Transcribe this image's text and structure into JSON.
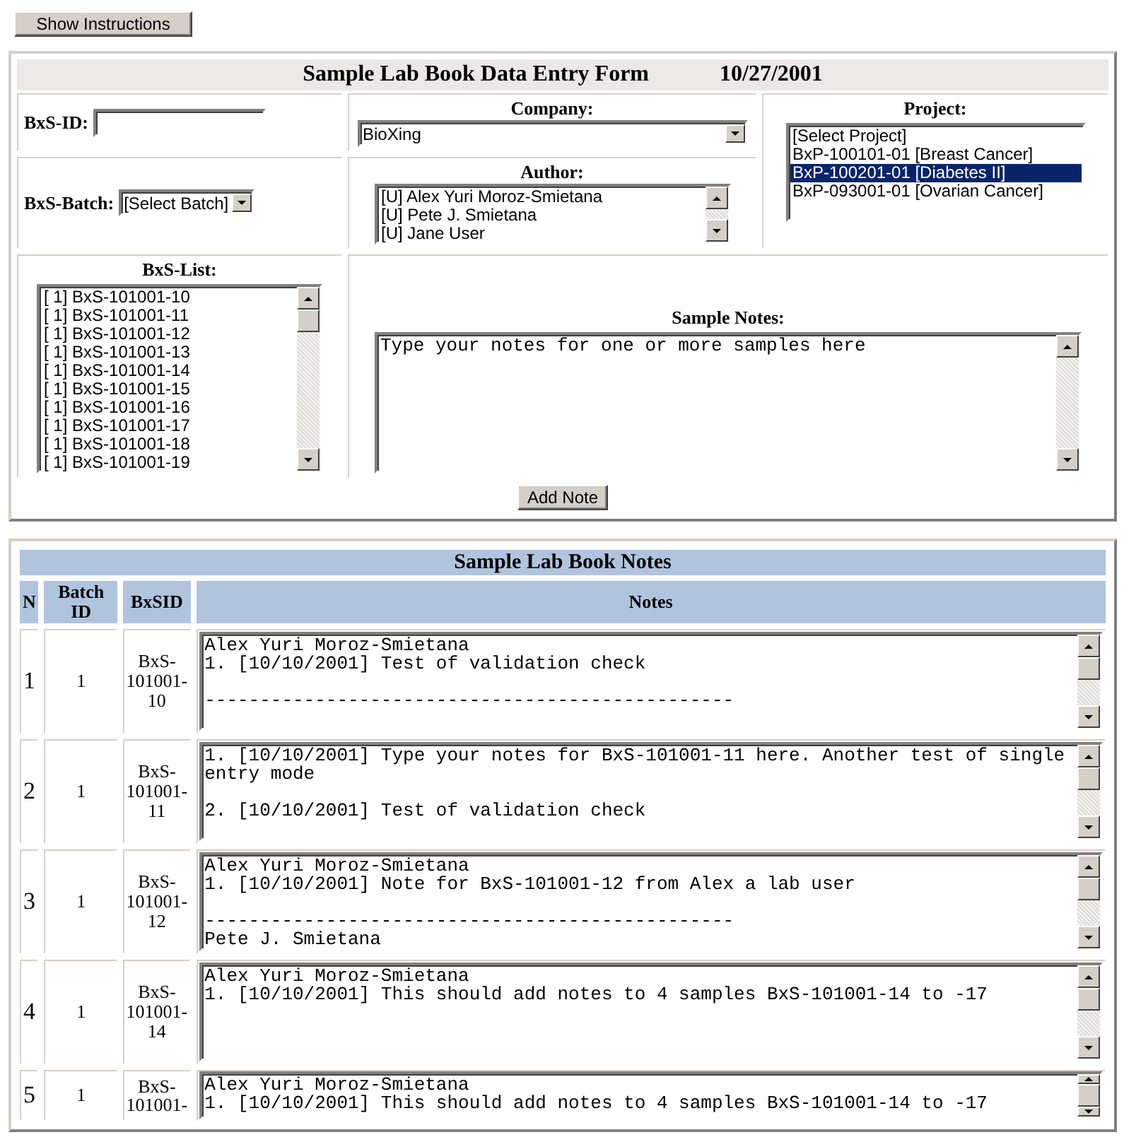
{
  "toolbar": {
    "show_instructions": "Show Instructions"
  },
  "entry_form": {
    "title": "Sample Lab Book Data Entry Form",
    "date": "10/27/2001",
    "bxs_id": {
      "label": "BxS-ID:"
    },
    "company": {
      "label": "Company:",
      "value": "BioXing"
    },
    "project": {
      "label": "Project:",
      "options": [
        {
          "text": "[Select Project]",
          "selected": false
        },
        {
          "text": "BxP-100101-01 [Breast Cancer]",
          "selected": false
        },
        {
          "text": "BxP-100201-01 [Diabetes II]",
          "selected": true
        },
        {
          "text": "BxP-093001-01 [Ovarian Cancer]",
          "selected": false
        }
      ]
    },
    "bxs_batch": {
      "label": "BxS-Batch:",
      "value": "[Select Batch]"
    },
    "author": {
      "label": "Author:",
      "options": [
        "[U] Alex Yuri Moroz-Smietana",
        "[U] Pete J. Smietana",
        "[U] Jane User"
      ]
    },
    "bxs_list": {
      "label": "BxS-List:",
      "items": [
        "[ 1] BxS-101001-10",
        "[ 1] BxS-101001-11",
        "[ 1] BxS-101001-12",
        "[ 1] BxS-101001-13",
        "[ 1] BxS-101001-14",
        "[ 1] BxS-101001-15",
        "[ 1] BxS-101001-16",
        "[ 1] BxS-101001-17",
        "[ 1] BxS-101001-18",
        "[ 1] BxS-101001-19"
      ]
    },
    "sample_notes": {
      "label": "Sample Notes:",
      "value": "Type your notes for one or more samples here"
    },
    "add_note": "Add Note"
  },
  "notes_table": {
    "title": "Sample Lab Book Notes",
    "columns": [
      "N",
      "Batch ID",
      "BxSID",
      "Notes"
    ],
    "rows": [
      {
        "n": "1",
        "batch_id": "1",
        "bxsid": "BxS-101001-10",
        "notes": "Alex Yuri Moroz-Smietana\n1. [10/10/2001] Test of validation check\n\n------------------------------------------------"
      },
      {
        "n": "2",
        "batch_id": "1",
        "bxsid": "BxS-101001-11",
        "notes": "1. [10/10/2001] Type your notes for BxS-101001-11 here. Another test of single entry mode\n\n2. [10/10/2001] Test of validation check"
      },
      {
        "n": "3",
        "batch_id": "1",
        "bxsid": "BxS-101001-12",
        "notes": "Alex Yuri Moroz-Smietana\n1. [10/10/2001] Note for BxS-101001-12 from Alex a lab user\n\n------------------------------------------------\nPete J. Smietana"
      },
      {
        "n": "4",
        "batch_id": "1",
        "bxsid": "BxS-101001-14",
        "notes": "Alex Yuri Moroz-Smietana\n1. [10/10/2001] This should add notes to 4 samples BxS-101001-14 to -17"
      },
      {
        "n": "5",
        "batch_id": "1",
        "bxsid": "BxS-101001-",
        "notes": "Alex Yuri Moroz-Smietana\n1. [10/10/2001] This should add notes to 4 samples BxS-101001-14 to -17"
      }
    ]
  }
}
